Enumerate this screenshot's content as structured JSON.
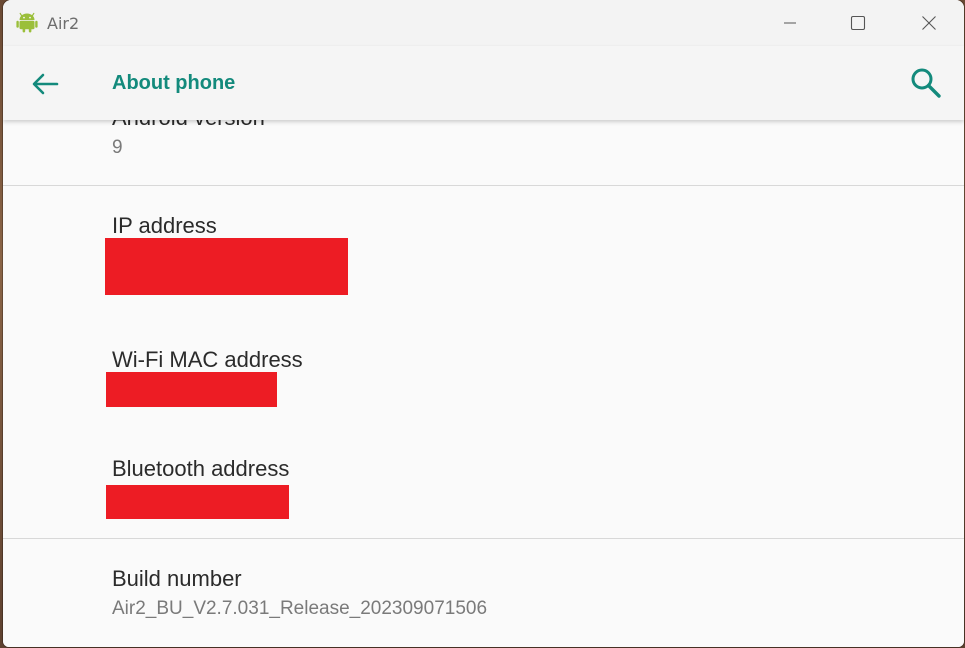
{
  "window": {
    "title": "Air2",
    "icon": "android-icon",
    "controls": [
      "minimize-icon",
      "maximize-icon",
      "close-icon"
    ]
  },
  "appbar": {
    "title": "About phone",
    "back_icon": "arrow-left-icon",
    "search_icon": "search-icon"
  },
  "colors": {
    "accent": "#138a7c",
    "redaction": "#ed1c24",
    "android_green": "#9bbf3a"
  },
  "prefs": [
    {
      "title": "Android version",
      "summary": "9"
    },
    {
      "title": "IP address",
      "summary": ""
    },
    {
      "title": "Wi-Fi MAC address",
      "summary": ""
    },
    {
      "title": "Bluetooth address",
      "summary": ""
    },
    {
      "title": "Build number",
      "summary": "Air2_BU_V2.7.031_Release_202309071506"
    }
  ]
}
